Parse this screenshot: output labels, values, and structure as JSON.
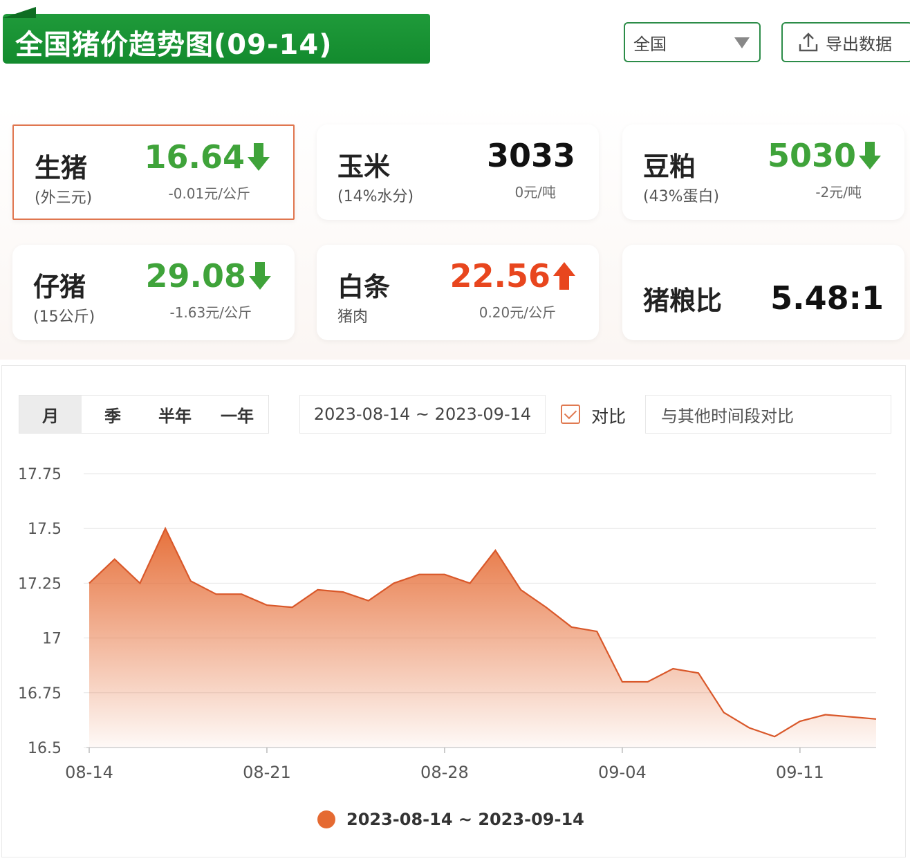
{
  "header": {
    "title": "全国猪价趋势图(09-14)",
    "region_value": "全国",
    "export_label": "导出数据"
  },
  "cards": [
    {
      "name": "生猪",
      "sub": "(外三元)",
      "price": "16.64",
      "change": "-0.01元/公斤",
      "trend": "down"
    },
    {
      "name": "玉米",
      "sub": "(14%水分)",
      "price": "3033",
      "change": "0元/吨",
      "trend": "flat"
    },
    {
      "name": "豆粕",
      "sub": "(43%蛋白)",
      "price": "5030",
      "change": "-2元/吨",
      "trend": "down"
    },
    {
      "name": "仔猪",
      "sub": "(15公斤)",
      "price": "29.08",
      "change": "-1.63元/公斤",
      "trend": "down"
    },
    {
      "name": "白条",
      "sub": "猪肉",
      "price": "22.56",
      "change": "0.20元/公斤",
      "trend": "up"
    },
    {
      "name": "猪粮比",
      "price": "5.48:1",
      "trend": "none"
    }
  ],
  "colors": {
    "up": "#e8461e",
    "down": "#3fa33a",
    "accent": "#e56a32",
    "brand_green": "#138b2e"
  },
  "chart_panel": {
    "tabs": [
      "月",
      "季",
      "半年",
      "一年"
    ],
    "active_tab": "月",
    "date_range": "2023-08-14 ~ 2023-09-14",
    "compare_label": "对比",
    "compare_checked": true,
    "compare_placeholder": "与其他时间段对比",
    "legend": "2023-08-14 ~ 2023-09-14"
  },
  "chart_data": {
    "type": "area",
    "series": [
      {
        "name": "2023-08-14 ~ 2023-09-14",
        "x": [
          "08-14",
          "08-15",
          "08-16",
          "08-17",
          "08-18",
          "08-19",
          "08-20",
          "08-21",
          "08-22",
          "08-23",
          "08-24",
          "08-25",
          "08-26",
          "08-27",
          "08-28",
          "08-29",
          "08-30",
          "08-31",
          "09-01",
          "09-02",
          "09-03",
          "09-04",
          "09-05",
          "09-06",
          "09-07",
          "09-08",
          "09-09",
          "09-10",
          "09-11",
          "09-12",
          "09-13",
          "09-14"
        ],
        "values": [
          17.25,
          17.36,
          17.25,
          17.5,
          17.26,
          17.2,
          17.2,
          17.15,
          17.14,
          17.22,
          17.21,
          17.17,
          17.25,
          17.29,
          17.29,
          17.25,
          17.4,
          17.22,
          17.14,
          17.05,
          17.03,
          16.8,
          16.8,
          16.86,
          16.84,
          16.66,
          16.59,
          16.55,
          16.62,
          16.65,
          16.64,
          16.63
        ]
      }
    ],
    "x_tick_labels": [
      "08-14",
      "08-21",
      "08-28",
      "09-04",
      "09-11"
    ],
    "y_tick_labels": [
      "16.5",
      "16.75",
      "17",
      "17.25",
      "17.5",
      "17.75"
    ],
    "ylim": [
      16.5,
      17.75
    ],
    "grid": true,
    "legend_position": "bottom-center"
  }
}
